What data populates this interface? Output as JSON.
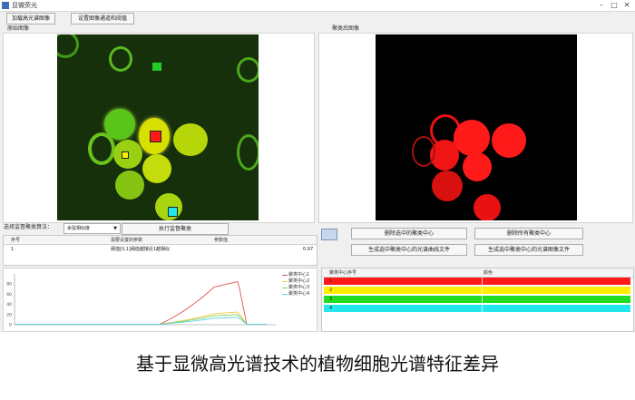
{
  "window": {
    "title": "显微荧光"
  },
  "toolbar": {
    "load_button": "加载高光谱图像",
    "set_threshold_button": "设置图像通道和阈值"
  },
  "original_panel": {
    "label": "原始图像"
  },
  "result_panel": {
    "label": "聚类后图像"
  },
  "controls": {
    "algorithm_label": "选择监督聚类算法：",
    "algorithm_value": "余弦相似度",
    "run_button": "执行监督聚类"
  },
  "param_table": {
    "headers": [
      "序号",
      "需要设置的参数",
      "参数值"
    ],
    "rows": [
      {
        "index": "1",
        "param": "阈值[0,1]阈值越接近1越相似",
        "value": "0.97"
      }
    ]
  },
  "right_controls": {
    "delete_selected": "删除选中的聚类中心",
    "delete_all": "删除所有聚类中心",
    "gen_selected": "生成选中聚类中心的光谱曲线文件",
    "gen_all": "生成选中聚类中心的光谱图像文件"
  },
  "chart_data": {
    "type": "line",
    "ylim": [
      0,
      100
    ],
    "y_ticks": [
      "80",
      "60",
      "40",
      "20",
      "0"
    ],
    "series": [
      {
        "name": "聚类中心1",
        "color": "#e05050"
      },
      {
        "name": "聚类中心2",
        "color": "#f2c94c"
      },
      {
        "name": "聚类中心3",
        "color": "#7ed957"
      },
      {
        "name": "聚类中心4",
        "color": "#5ed3e8"
      }
    ]
  },
  "center_table": {
    "headers": [
      "聚类中心序号",
      "颜色"
    ],
    "rows": [
      {
        "index": "1",
        "color": "#ff1a1a"
      },
      {
        "index": "2",
        "color": "#ffee00"
      },
      {
        "index": "3",
        "color": "#22dd22"
      },
      {
        "index": "4",
        "color": "#22e8ee"
      }
    ]
  },
  "caption": "基于显微高光谱技术的植物细胞光谱特征差异"
}
